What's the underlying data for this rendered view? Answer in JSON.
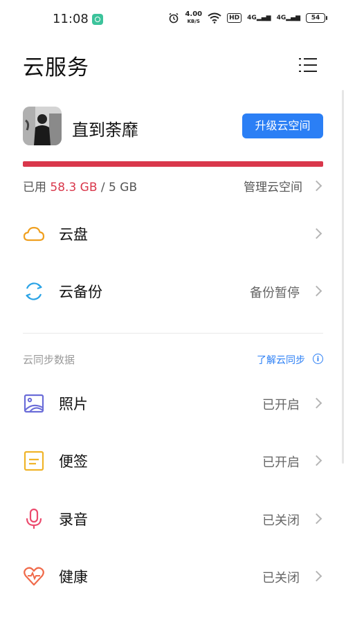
{
  "status_bar": {
    "time": "11:08",
    "net_speed_value": "4.00",
    "net_speed_unit": "KB/S",
    "hd_label": "HD",
    "signal_1": "4G",
    "signal_2": "4G",
    "battery": "54",
    "icons": [
      "app-notification-icon",
      "alarm-icon",
      "wifi-icon",
      "hd-icon",
      "signal-icon",
      "battery-icon"
    ]
  },
  "header": {
    "title": "云服务",
    "menu_icon": "list-menu-icon"
  },
  "profile": {
    "username": "直到荼靡",
    "upgrade_label": "升级云空间"
  },
  "storage": {
    "prefix": "已用",
    "used": "58.3 GB",
    "separator": " / ",
    "total": "5 GB",
    "used_fraction": 1.0,
    "bar_color": "#d9374b",
    "manage_label": "管理云空间"
  },
  "main_items": [
    {
      "label": "云盘",
      "status": "",
      "icon": "cloud-icon"
    },
    {
      "label": "云备份",
      "status": "备份暂停",
      "icon": "sync-icon"
    }
  ],
  "sync_section": {
    "title": "云同步数据",
    "learn_label": "了解云同步",
    "info_glyph": "i",
    "items": [
      {
        "label": "照片",
        "status": "已开启",
        "icon": "photos-icon"
      },
      {
        "label": "便签",
        "status": "已开启",
        "icon": "notes-icon"
      },
      {
        "label": "录音",
        "status": "已关闭",
        "icon": "microphone-icon"
      },
      {
        "label": "健康",
        "status": "已关闭",
        "icon": "health-heart-icon"
      }
    ]
  },
  "colors": {
    "accent": "#2b7ff5",
    "danger": "#d9374b"
  }
}
